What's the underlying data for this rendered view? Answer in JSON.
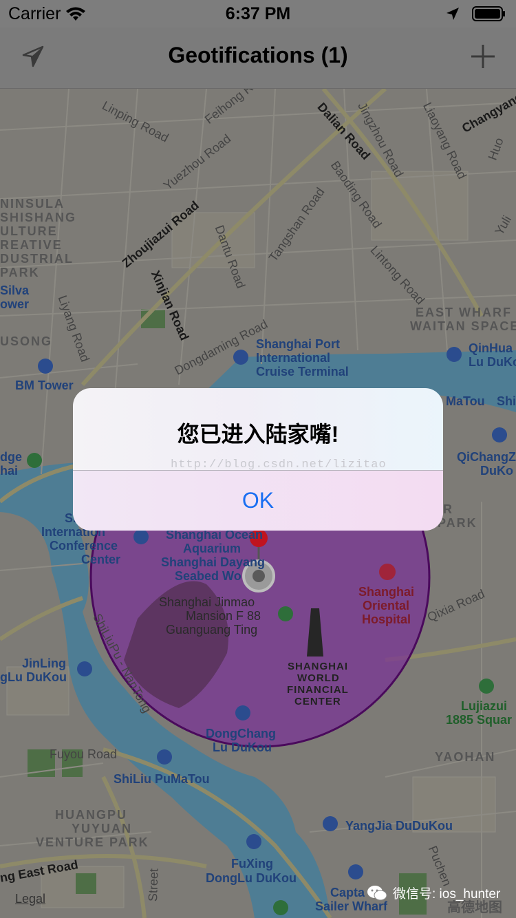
{
  "status_bar": {
    "carrier": "Carrier",
    "time": "6:37 PM"
  },
  "nav": {
    "title": "Geotifications (1)",
    "left_icon": "location-arrow-icon",
    "right_icon": "plus-icon"
  },
  "alert": {
    "title": "您已进入陆家嘴!",
    "ok_label": "OK",
    "watermark": "http://blog.csdn.net/lizitao"
  },
  "map": {
    "roads": [
      "Linping Road",
      "Feihong Road",
      "Dalian Road",
      "Jingzhou Road",
      "Liaoyang Road",
      "Changyang",
      "Huo",
      "Yuezhou Road",
      "Zhoujiazui Road",
      "Dantu Road",
      "Tangshan Road",
      "Baoding Road",
      "Lintong Road",
      "Xinjian Road",
      "Liyang Road",
      "Dongdaming Road",
      "Qixia Road",
      "ShiLiuPu - NanTong",
      "Fuyou Road",
      "ng East Road",
      "Street",
      "Puchen",
      "Yuli"
    ],
    "districts": [
      "NINSULA",
      "SHISHANG",
      "ULTURE",
      "REATIVE",
      "DUSTRIAL",
      "PARK",
      "EAST WHARF",
      "WAITAN SPACE",
      "HUANGPU",
      "YUYUAN",
      "VENTURE PARK",
      "R",
      "PARK",
      "YAOHAN",
      "USONG"
    ],
    "pois": [
      "Shanghai Port",
      "International",
      "Cruise Terminal",
      "QinHua",
      "Lu DuKo",
      "MaTou",
      "Shi",
      "QiChangZ",
      "DuKo",
      "BM Tower",
      "Silva",
      "ower",
      "dge",
      "hai",
      "Shanghai Ocean",
      "Aquarium",
      "Shanghai Dayang",
      "Seabed Wo",
      "Internation",
      "Conference",
      "Center",
      "Sh",
      "JinLing",
      "gLu DuKou",
      "DongChang",
      "Lu DuKou",
      "ShiLiu PuMaTou",
      "YangJia DuDuKou",
      "FuXing",
      "DongLu DuKou",
      "Capta",
      "Sailer Wharf"
    ],
    "landmarks": [
      "Shanghai Jinmao",
      "Mansion F 88",
      "Guanguang Ting",
      "SHANGHAI",
      "WORLD",
      "FINANCIAL",
      "CENTER"
    ],
    "hospital": [
      "Shanghai",
      "Oriental",
      "Hospital"
    ],
    "metro": [
      "Lujiazui",
      "1885 Squar"
    ],
    "legal": "Legal",
    "wechat_credit": "微信号: ios_hunter",
    "provider": "高德地图"
  },
  "geofence": {
    "fill": "#7a2a9a",
    "stroke": "#4a0a5c",
    "pin": "#c0141f"
  },
  "colors": {
    "accent": "#1a6ff2",
    "water": "#4e8aa8"
  }
}
